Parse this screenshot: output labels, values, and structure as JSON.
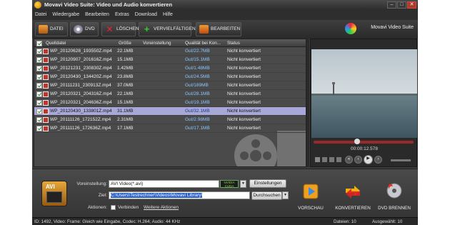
{
  "window": {
    "title": "Movavi Video Suite: Video und Audio konvertieren"
  },
  "menu": [
    "Datei",
    "Wiedergabe",
    "Bearbeiten",
    "Extras",
    "Download",
    "Hilfe"
  ],
  "toolbar": {
    "datei": "DATEI",
    "dvd": "DVD",
    "loeschen": "LÖSCHEN",
    "vervielfaeltigen": "VERVIELFÄLTIGEN",
    "bearbeiten": "BEARBEITEN",
    "brand": "Movavi Video Suite"
  },
  "list": {
    "columns": {
      "file": "Quelldatei",
      "size": "Größe",
      "preset": "Voreinstellung",
      "quality": "Qualität bei Kon...",
      "status": "Status"
    },
    "rows": [
      {
        "file": "WP_20120628_193550Z.mp4",
        "size": "22.1MB",
        "quality": "Gut/22.7MB",
        "status": "Nicht konvertiert"
      },
      {
        "file": "WP_20120907_201616Z.mp4",
        "size": "15.1MB",
        "quality": "Gut/15.1MB",
        "status": "Nicht konvertiert"
      },
      {
        "file": "WP_20121231_230830Z.mp4",
        "size": "1.42MB",
        "quality": "Gut/1.48MB",
        "status": "Nicht konvertiert"
      },
      {
        "file": "WP_20120430_134420Z.mp4",
        "size": "23.8MB",
        "quality": "Gut/24.5MB",
        "status": "Nicht konvertiert"
      },
      {
        "file": "WP_20111231_230913Z.mp4",
        "size": "37.0MB",
        "quality": "Gut/189MB",
        "status": "Nicht konvertiert"
      },
      {
        "file": "WP_20120321_204316Z.mp4",
        "size": "22.1MB",
        "quality": "Gut/28.1MB",
        "status": "Nicht konvertiert"
      },
      {
        "file": "WP_20120321_204636Z.mp4",
        "size": "15.1MB",
        "quality": "Gut/19.1MB",
        "status": "Nicht konvertiert"
      },
      {
        "file": "WP_20120430_133801Z.mp4",
        "size": "31.1MB",
        "quality": "Gut/32.1MB",
        "status": "Nicht konvertiert"
      },
      {
        "file": "WP_20111126_172152Z.mp4",
        "size": "2.31MB",
        "quality": "Gut/2.98MB",
        "status": "Nicht konvertiert"
      },
      {
        "file": "WP_20111126_172636Z.mp4",
        "size": "17.1MB",
        "quality": "Gut/17.1MB",
        "status": "Nicht konvertiert"
      }
    ]
  },
  "player": {
    "time": "00:00:12.578",
    "seek_fraction": 0.43
  },
  "output": {
    "preset_label": "Voreinstellung:",
    "preset_value": "AVI Video(*.avi)",
    "cuda": "NVIDIA CUDA",
    "settings_button": "Einstellungen",
    "target_label": "Ziel:",
    "target_value": "C:\\Users\\Testrechner\\Videos\\Movavi Library\\",
    "browse_button": "Durchsuchen",
    "actions_label": "Aktionen:",
    "join_label": "Verbinden",
    "more_actions": "Weitere Aktionen",
    "format_badge": "AVI"
  },
  "actions": {
    "preview": "VORSCHAU",
    "convert": "KONVERTIEREN",
    "burn": "DVD BRENNEN"
  },
  "status": {
    "info": "ID: 1492, Video: Frame: Gleich wie Eingabe, Codec: H.264; Audio: 44 KHz",
    "files": "Dateien: 10",
    "selected": "Ausgewählt: 10"
  }
}
